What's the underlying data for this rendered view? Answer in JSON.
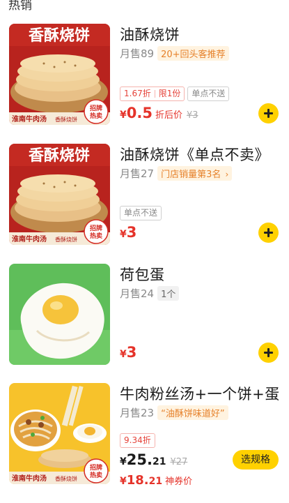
{
  "section": {
    "title": "热销"
  },
  "items": [
    {
      "name": "油酥烧饼",
      "sold": "月售89",
      "tag": "20+回头客推荐",
      "discount_tags": [
        "1.67折",
        "限1份"
      ],
      "note_tag": "单点不送",
      "currency": "¥",
      "price": "0.5",
      "price_label": "折后价",
      "original_price": "¥3",
      "image": {
        "banner": "香酥烧饼",
        "brand": "淮南牛肉汤",
        "brand_sub": "香酥烧饼",
        "badge": "招牌\n热卖"
      }
    },
    {
      "name": "油酥烧饼《单点不卖》",
      "sold": "月售27",
      "tag": "门店销量第3名",
      "note_tag": "单点不送",
      "currency": "¥",
      "price": "3",
      "image": {
        "banner": "香酥烧饼",
        "brand": "淮南牛肉汤",
        "brand_sub": "香酥烧饼",
        "badge": "招牌\n热卖"
      }
    },
    {
      "name": "荷包蛋",
      "sold": "月售24",
      "tag": "1个",
      "currency": "¥",
      "price": "3"
    },
    {
      "name": "牛肉粉丝汤+一个饼+蛋",
      "sold": "月售23",
      "tag": "“油酥饼味道好”",
      "discount_tag": "9.34折",
      "currency": "¥",
      "price_int": "25.",
      "price_dec": "21",
      "original_price": "¥27",
      "coupon_price_int": "18.",
      "coupon_price_dec": "21",
      "coupon_label": "神券价",
      "spec_button": "选规格",
      "image": {
        "brand": "淮南牛肉汤",
        "brand_sub": "香酥烧饼",
        "badge": "招牌\n热卖"
      }
    }
  ],
  "colors": {
    "accent": "#ffd100",
    "price_red": "#e5332a",
    "tag_orange": "#e6812a"
  },
  "icons": {
    "add": "plus-icon",
    "chevron": "chevron-right-icon"
  }
}
